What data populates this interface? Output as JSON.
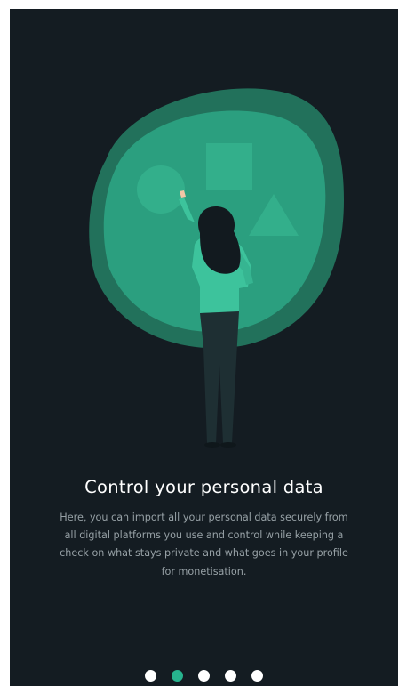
{
  "onboarding": {
    "title": "Control your personal data",
    "description": "Here, you can import all your personal data securely from all digital platforms you use and control while keeping a check on what stays private and what goes in your profile for monetisation."
  },
  "pager": {
    "total": 5,
    "active_index": 1
  },
  "colors": {
    "background": "#141c22",
    "accent": "#27b38e",
    "blob_outer": "#237b62",
    "blob_inner": "#2b9f7f",
    "dot_inactive": "#ffffff"
  },
  "illustration": {
    "shapes": [
      "circle-shape",
      "square-shape",
      "triangle-shape"
    ],
    "figure": "woman-pointing-figure"
  }
}
